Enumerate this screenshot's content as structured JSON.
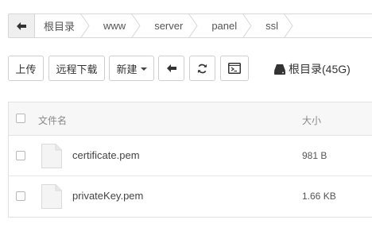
{
  "breadcrumb": {
    "back_icon": "arrow-left-icon",
    "items": [
      "根目录",
      "www",
      "server",
      "panel",
      "ssl"
    ]
  },
  "toolbar": {
    "upload_label": "上传",
    "remote_download_label": "远程下载",
    "new_label": "新建",
    "back_icon": "arrow-left-icon",
    "refresh_icon": "refresh-icon",
    "terminal_icon": "terminal-icon",
    "disk_icon": "hdd-icon",
    "disk_label": "根目录(45G)"
  },
  "table": {
    "headers": {
      "name": "文件名",
      "size": "大小"
    },
    "rows": [
      {
        "name": "certificate.pem",
        "size": "981 B"
      },
      {
        "name": "privateKey.pem",
        "size": "1.66 KB"
      }
    ]
  }
}
